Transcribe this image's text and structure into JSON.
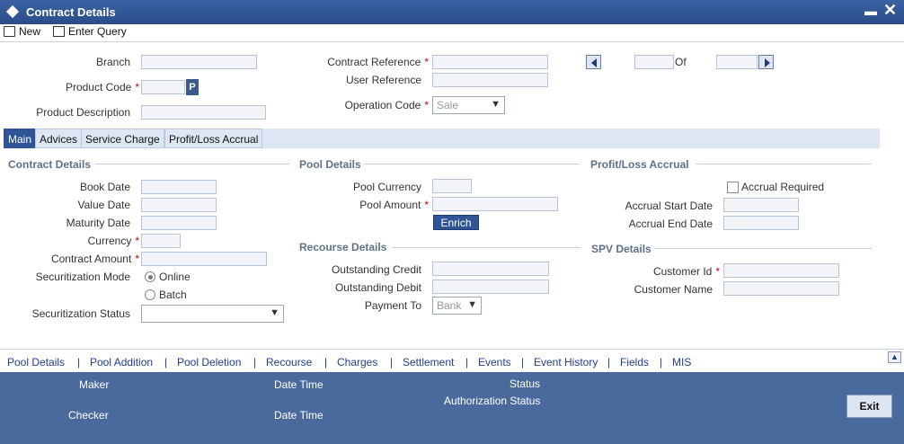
{
  "window": {
    "title": "Contract Details"
  },
  "toolbar": {
    "new_label": "New",
    "enter_query_label": "Enter Query"
  },
  "header": {
    "branch_label": "Branch",
    "product_code_label": "Product Code",
    "product_lov_label": "P",
    "product_description_label": "Product Description",
    "contract_reference_label": "Contract Reference",
    "user_reference_label": "User Reference",
    "operation_code_label": "Operation Code",
    "operation_code_value": "Sale",
    "of_label": "Of",
    "required_mark": "*"
  },
  "tabs": [
    "Main",
    "Advices",
    "Service Charge",
    "Profit/Loss Accrual"
  ],
  "contract_details": {
    "section_title": "Contract Details",
    "book_date_label": "Book Date",
    "value_date_label": "Value Date",
    "maturity_date_label": "Maturity Date",
    "currency_label": "Currency",
    "contract_amount_label": "Contract Amount",
    "securitization_mode_label": "Securitization Mode",
    "online_label": "Online",
    "batch_label": "Batch",
    "securitization_status_label": "Securitization Status"
  },
  "pool_details": {
    "section_title": "Pool Details",
    "pool_currency_label": "Pool Currency",
    "pool_amount_label": "Pool Amount",
    "enrich_label": "Enrich"
  },
  "recourse_details": {
    "section_title": "Recourse Details",
    "outstanding_credit_label": "Outstanding Credit",
    "outstanding_debit_label": "Outstanding Debit",
    "payment_to_label": "Payment To",
    "payment_to_value": "Bank"
  },
  "profit_loss_accrual": {
    "section_title": "Profit/Loss Accrual",
    "accrual_required_label": "Accrual Required",
    "accrual_start_date_label": "Accrual Start Date",
    "accrual_end_date_label": "Accrual End Date"
  },
  "spv_details": {
    "section_title": "SPV Details",
    "customer_id_label": "Customer Id",
    "customer_name_label": "Customer Name"
  },
  "links": [
    "Pool Details",
    "Pool Addition",
    "Pool Deletion",
    "Recourse",
    "Charges",
    "Settlement",
    "Events",
    "Event History",
    "Fields",
    "MIS"
  ],
  "link_separator": "|",
  "footer": {
    "maker_label": "Maker",
    "checker_label": "Checker",
    "date_time_label": "Date Time",
    "status_label": "Status",
    "authorization_status_label": "Authorization Status",
    "exit_label": "Exit"
  },
  "colors": {
    "titlebar": "#2b4d8a",
    "accent": "#2f5597",
    "footer": "#4a6a9e",
    "required": "#cc0000"
  }
}
